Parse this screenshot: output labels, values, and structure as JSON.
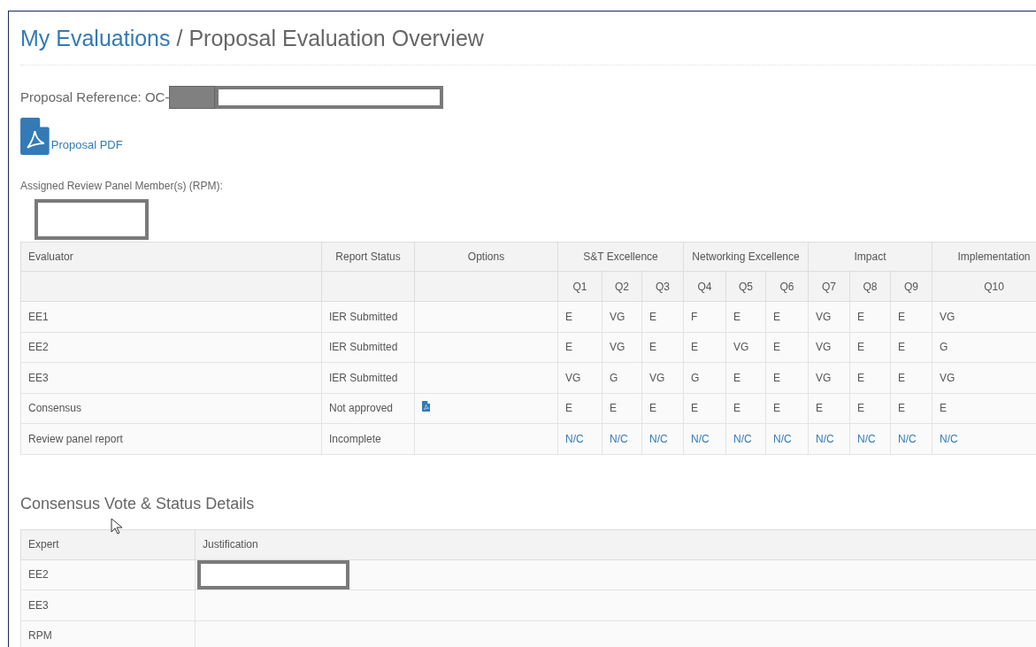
{
  "breadcrumb": {
    "link": "My Evaluations",
    "separator": "/",
    "current": "Proposal Evaluation Overview"
  },
  "proposal_reference": {
    "label": "Proposal Reference: OC-",
    "redacted": true
  },
  "proposal_pdf": {
    "label": "Proposal PDF"
  },
  "rpm": {
    "label": "Assigned Review Panel Member(s) (RPM):",
    "redacted": true
  },
  "evaluation_table": {
    "columns": [
      "Evaluator",
      "Report Status",
      "Options"
    ],
    "groups": [
      {
        "label": "S&T Excellence",
        "questions": [
          "Q1",
          "Q2",
          "Q3"
        ]
      },
      {
        "label": "Networking Excellence",
        "questions": [
          "Q4",
          "Q5",
          "Q6"
        ]
      },
      {
        "label": "Impact",
        "questions": [
          "Q7",
          "Q8",
          "Q9"
        ]
      },
      {
        "label": "Implementation",
        "questions": [
          "Q10"
        ]
      }
    ],
    "rows": [
      {
        "evaluator": "EE1",
        "status": "IER Submitted",
        "pdf_option": false,
        "kind": "text",
        "scores": [
          "E",
          "VG",
          "E",
          "F",
          "E",
          "E",
          "VG",
          "E",
          "E",
          "VG"
        ]
      },
      {
        "evaluator": "EE2",
        "status": "IER Submitted",
        "pdf_option": false,
        "kind": "text",
        "scores": [
          "E",
          "VG",
          "E",
          "E",
          "VG",
          "E",
          "VG",
          "E",
          "E",
          "G"
        ]
      },
      {
        "evaluator": "EE3",
        "status": "IER Submitted",
        "pdf_option": false,
        "kind": "text",
        "scores": [
          "VG",
          "G",
          "VG",
          "G",
          "E",
          "E",
          "VG",
          "E",
          "E",
          "VG"
        ]
      },
      {
        "evaluator": "Consensus",
        "status": "Not approved",
        "pdf_option": true,
        "kind": "text",
        "scores": [
          "E",
          "E",
          "E",
          "E",
          "E",
          "E",
          "E",
          "E",
          "E",
          "E"
        ]
      },
      {
        "evaluator": "Review panel report",
        "status": "Incomplete",
        "pdf_option": false,
        "kind": "link",
        "scores": [
          "N/C",
          "N/C",
          "N/C",
          "N/C",
          "N/C",
          "N/C",
          "N/C",
          "N/C",
          "N/C",
          "N/C"
        ]
      }
    ]
  },
  "consensus_section": {
    "title": "Consensus Vote & Status Details",
    "columns": [
      "Expert",
      "Justification"
    ],
    "rows": [
      {
        "expert": "EE2",
        "redacted": true
      },
      {
        "expert": "EE3",
        "redacted": false
      },
      {
        "expert": "RPM",
        "redacted": false
      }
    ]
  }
}
